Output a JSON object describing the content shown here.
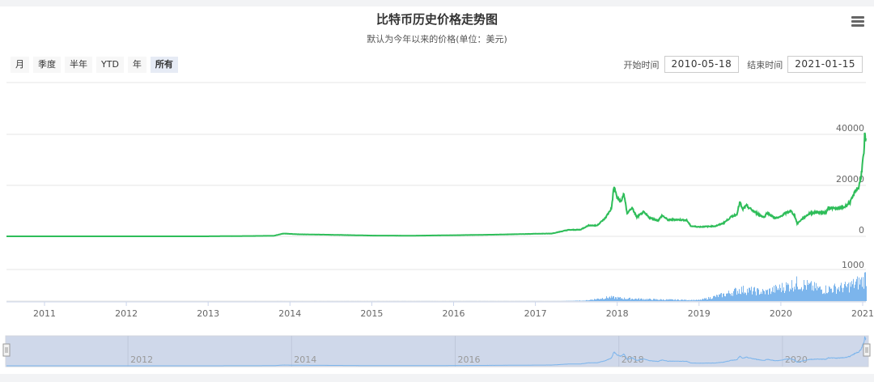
{
  "header": {
    "title": "比特币历史价格走势图",
    "subtitle": "默认为今年以来的价格(单位：美元)",
    "menu_icon": "hamburger-menu-icon"
  },
  "range_selector": {
    "buttons": [
      "月",
      "季度",
      "半年",
      "YTD",
      "年",
      "所有"
    ],
    "active": "所有"
  },
  "date_inputs": {
    "start_label": "开始时间",
    "start_value": "2010-05-18",
    "end_label": "结束时间",
    "end_value": "2021-01-15"
  },
  "colors": {
    "price": "#2ebd59",
    "volume": "#7cb5ec",
    "navigator_mask": "#cfd8ea"
  },
  "chart_data": {
    "type": "line",
    "title": "比特币历史价格走势图",
    "x_ticks": [
      "2011",
      "2012",
      "2013",
      "2014",
      "2015",
      "2016",
      "2017",
      "2018",
      "2019",
      "2020",
      "2021"
    ],
    "price_axis": {
      "ticks": [
        "0",
        "20000",
        "40000"
      ],
      "ylim": [
        0,
        40000
      ]
    },
    "volume_axis": {
      "ticks": [
        "0",
        "1000"
      ],
      "ylim": [
        0,
        1000
      ]
    },
    "navigator_ticks": [
      "2012",
      "2014",
      "2016",
      "2018",
      "2020"
    ],
    "price_series": [
      [
        2010.38,
        0.1
      ],
      [
        2013.0,
        13
      ],
      [
        2013.8,
        200
      ],
      [
        2013.92,
        1100
      ],
      [
        2014.1,
        800
      ],
      [
        2014.5,
        600
      ],
      [
        2015.0,
        300
      ],
      [
        2015.5,
        250
      ],
      [
        2016.0,
        430
      ],
      [
        2016.5,
        650
      ],
      [
        2017.0,
        1000
      ],
      [
        2017.2,
        1100
      ],
      [
        2017.4,
        2500
      ],
      [
        2017.55,
        2600
      ],
      [
        2017.65,
        4300
      ],
      [
        2017.75,
        4200
      ],
      [
        2017.85,
        7000
      ],
      [
        2017.93,
        11000
      ],
      [
        2017.96,
        19500
      ],
      [
        2018.0,
        15000
      ],
      [
        2018.05,
        13500
      ],
      [
        2018.08,
        17000
      ],
      [
        2018.12,
        9000
      ],
      [
        2018.18,
        11200
      ],
      [
        2018.24,
        7500
      ],
      [
        2018.32,
        9500
      ],
      [
        2018.4,
        7200
      ],
      [
        2018.5,
        6200
      ],
      [
        2018.55,
        8200
      ],
      [
        2018.62,
        6400
      ],
      [
        2018.7,
        6600
      ],
      [
        2018.85,
        6300
      ],
      [
        2018.9,
        4000
      ],
      [
        2019.0,
        3700
      ],
      [
        2019.2,
        4000
      ],
      [
        2019.3,
        5200
      ],
      [
        2019.4,
        7800
      ],
      [
        2019.46,
        8500
      ],
      [
        2019.5,
        13500
      ],
      [
        2019.53,
        10500
      ],
      [
        2019.58,
        12000
      ],
      [
        2019.65,
        10200
      ],
      [
        2019.75,
        8200
      ],
      [
        2019.8,
        7500
      ],
      [
        2019.83,
        9300
      ],
      [
        2019.92,
        7300
      ],
      [
        2019.97,
        7200
      ],
      [
        2020.05,
        9000
      ],
      [
        2020.12,
        10000
      ],
      [
        2020.17,
        8000
      ],
      [
        2020.2,
        5000
      ],
      [
        2020.26,
        6800
      ],
      [
        2020.35,
        9000
      ],
      [
        2020.45,
        9500
      ],
      [
        2020.55,
        9200
      ],
      [
        2020.58,
        11300
      ],
      [
        2020.68,
        10800
      ],
      [
        2020.78,
        11500
      ],
      [
        2020.85,
        13500
      ],
      [
        2020.88,
        15500
      ],
      [
        2020.92,
        18500
      ],
      [
        2020.95,
        19000
      ],
      [
        2020.98,
        23500
      ],
      [
        2021.0,
        29000
      ],
      [
        2021.02,
        34000
      ],
      [
        2021.025,
        41000
      ],
      [
        2021.035,
        36000
      ],
      [
        2021.04,
        38500
      ]
    ],
    "volume_envelope": [
      [
        2010.38,
        0
      ],
      [
        2017.3,
        2
      ],
      [
        2017.6,
        20
      ],
      [
        2017.9,
        150
      ],
      [
        2018.1,
        100
      ],
      [
        2018.5,
        60
      ],
      [
        2019.0,
        40
      ],
      [
        2019.3,
        250
      ],
      [
        2019.5,
        450
      ],
      [
        2019.8,
        350
      ],
      [
        2020.2,
        700
      ],
      [
        2020.5,
        450
      ],
      [
        2020.8,
        550
      ],
      [
        2021.0,
        800
      ],
      [
        2021.04,
        1000
      ]
    ]
  }
}
